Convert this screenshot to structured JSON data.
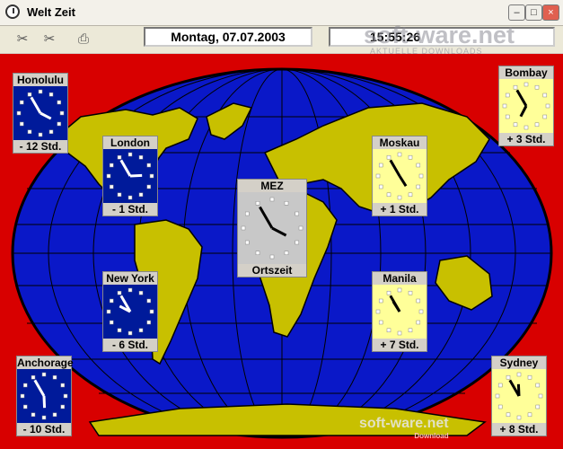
{
  "window": {
    "title": "Welt Zeit"
  },
  "toolbar": {
    "date": "Montag, 07.07.2003",
    "time": "15:55:26"
  },
  "watermark": {
    "brand": "soft-ware.net",
    "tagline": "AKTUELLE DOWNLOADS",
    "bottom_brand": "soft-ware.net",
    "bottom_tag": "Download"
  },
  "colors": {
    "ocean": "#0a18c8",
    "land": "#c8c000",
    "background": "#d80000",
    "clock_blue": "#001a9a",
    "clock_yellow": "#ffff99"
  },
  "clocks": [
    {
      "name": "Honolulu",
      "offset": "- 12 Std.",
      "style": "blue",
      "time": "03:55"
    },
    {
      "name": "London",
      "offset": "- 1 Std.",
      "style": "blue",
      "time": "14:55"
    },
    {
      "name": "New York",
      "offset": "- 6 Std.",
      "style": "blue",
      "time": "09:55"
    },
    {
      "name": "Anchorage",
      "offset": "- 10 Std.",
      "style": "blue",
      "time": "05:55"
    },
    {
      "name": "MEZ",
      "offset": "Ortszeit",
      "style": "grey",
      "time": "15:55"
    },
    {
      "name": "Moskau",
      "offset": "+ 1 Std.",
      "style": "yellow",
      "time": "16:55"
    },
    {
      "name": "Manila",
      "offset": "+ 7 Std.",
      "style": "yellow",
      "time": "22:55"
    },
    {
      "name": "Bombay",
      "offset": "+ 3 Std.",
      "style": "yellow",
      "time": "18:55"
    },
    {
      "name": "Sydney",
      "offset": "+ 8 Std.",
      "style": "yellow",
      "time": "23:55"
    }
  ]
}
